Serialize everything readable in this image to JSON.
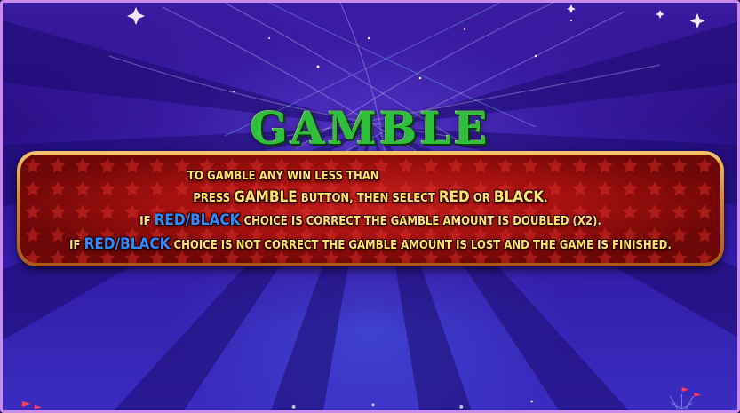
{
  "title": "GAMBLE",
  "rules": {
    "line1": "TO GAMBLE ANY WIN LESS THAN",
    "line2": {
      "a": "PRESS ",
      "b": "GAMBLE",
      "c": " BUTTON, THEN SELECT ",
      "d": "RED",
      "e": " OR ",
      "f": "BLACK",
      "g": "."
    },
    "line3": {
      "a": "IF ",
      "b": "RED/BLACK",
      "c": " CHOICE IS CORRECT THE GAMBLE AMOUNT IS DOUBLED (X2)."
    },
    "line4": {
      "a": "IF ",
      "b": "RED/BLACK",
      "c": " CHOICE IS NOT CORRECT THE GAMBLE AMOUNT IS LOST AND THE GAME IS FINISHED."
    }
  },
  "colors": {
    "title_green": "#2fbf3a",
    "text_yellow": "#ffe06a",
    "highlight_blue": "#2d8bff",
    "panel_red": "#b5140f",
    "panel_border": "#e0a048",
    "frame": "#c98be8"
  }
}
